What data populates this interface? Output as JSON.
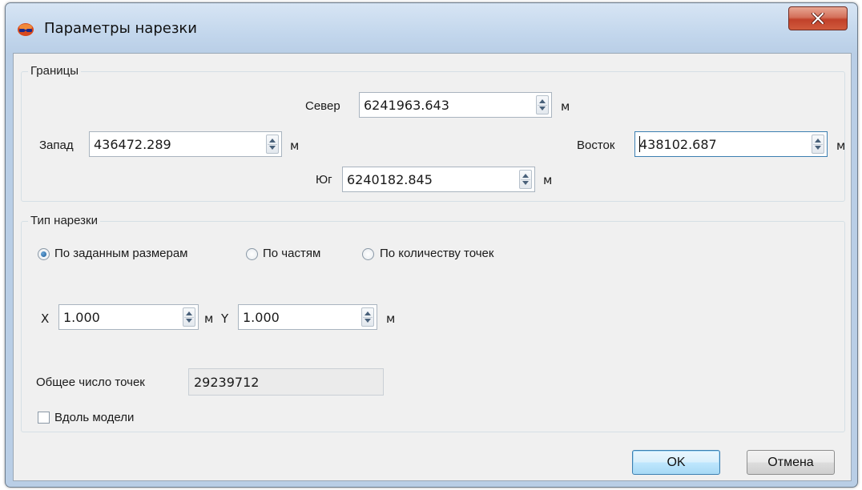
{
  "window": {
    "title": "Параметры нарезки"
  },
  "bounds": {
    "group_title": "Границы",
    "north": {
      "label": "Север",
      "value": "6241963.643",
      "unit": "м"
    },
    "west": {
      "label": "Запад",
      "value": "436472.289",
      "unit": "м"
    },
    "east": {
      "label": "Восток",
      "value": "438102.687",
      "unit": "м"
    },
    "south": {
      "label": "Юг",
      "value": "6240182.845",
      "unit": "м"
    }
  },
  "slicing": {
    "group_title": "Тип нарезки",
    "options": [
      {
        "label": "По заданным размерам",
        "selected": true
      },
      {
        "label": "По частям",
        "selected": false
      },
      {
        "label": "По количеству точек",
        "selected": false
      }
    ],
    "x": {
      "label": "X",
      "value": "1.000",
      "unit": "м"
    },
    "y": {
      "label": "Y",
      "value": "1.000",
      "unit": "м"
    },
    "total_points": {
      "label": "Общее число точек",
      "value": "29239712"
    },
    "along_model": {
      "label": "Вдоль модели",
      "checked": false
    }
  },
  "buttons": {
    "ok": "OK",
    "cancel": "Отмена"
  }
}
